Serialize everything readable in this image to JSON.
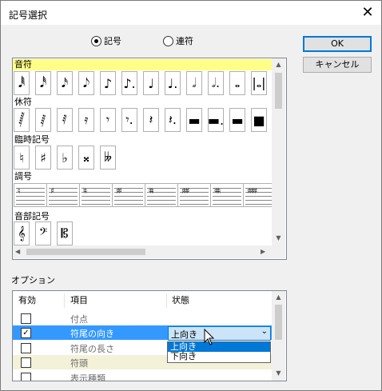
{
  "window": {
    "title": "記号選択",
    "close_glyph": "✕"
  },
  "mode": {
    "options": [
      "記号",
      "連符"
    ],
    "selected": "記号"
  },
  "buttons": {
    "ok": "OK",
    "cancel": "キャンセル"
  },
  "palette": {
    "sections": [
      {
        "label": "音符",
        "highlighted": true,
        "glyphs": [
          "𝅘𝅥𝅱",
          "𝅘𝅥𝅰",
          "𝅘𝅥𝅯",
          "𝅘𝅥𝅮",
          "♪",
          "♪.",
          "♩",
          "♩.",
          "𝅗𝅥",
          "𝅗𝅥.",
          "𝅝",
          "|𝅝|"
        ]
      },
      {
        "label": "休符",
        "highlighted": false,
        "glyphs": [
          "𝅂",
          "𝅁",
          "𝅀",
          "𝄿",
          "𝄾",
          "𝄾.",
          "𝄽",
          "𝄽.",
          "▬",
          "▬.",
          "▬",
          "■"
        ]
      },
      {
        "label": "臨時記号",
        "highlighted": false,
        "glyphs": [
          "♮",
          "♯",
          "♭",
          "𝄪",
          "𝄫"
        ]
      },
      {
        "label": "調号",
        "highlighted": false,
        "glyphs": [
          "♮",
          "♯",
          "♮♮",
          "♯♯",
          "♮♮♮",
          "♯♯♯",
          "♮♮♮♮",
          "♯♯♯♯"
        ]
      },
      {
        "label": "音部記号",
        "highlighted": false,
        "glyphs": [
          "𝄞",
          "𝄢",
          "𝄡"
        ]
      }
    ]
  },
  "options": {
    "label": "オプション",
    "columns": [
      "有効",
      "項目",
      "状態"
    ],
    "rows": [
      {
        "checked": false,
        "item": "付点",
        "state": ""
      },
      {
        "checked": true,
        "item": "符尾の向き",
        "state": "上向き",
        "selected": true
      },
      {
        "checked": false,
        "item": "符尾の長さ",
        "state": ""
      },
      {
        "checked": false,
        "item": "符頭",
        "state": "",
        "alt": true
      },
      {
        "checked": false,
        "item": "表示種類",
        "state": ""
      }
    ],
    "dropdown": {
      "value": "上向き",
      "choices": [
        "上向き",
        "下向き"
      ],
      "highlighted": "上向き"
    }
  },
  "icons": {
    "scroll_up": "up-arrow-icon",
    "scroll_down": "down-arrow-icon",
    "scroll_left": "left-arrow-icon",
    "scroll_right": "right-arrow-icon",
    "checkmark": "check-icon",
    "pointer": "mouse-pointer-icon"
  },
  "colors": {
    "section_highlight": "#ffff88",
    "selection": "#3399ff",
    "dropdown_highlight": "#0078d7",
    "alt_row": "#f3f1d8"
  }
}
